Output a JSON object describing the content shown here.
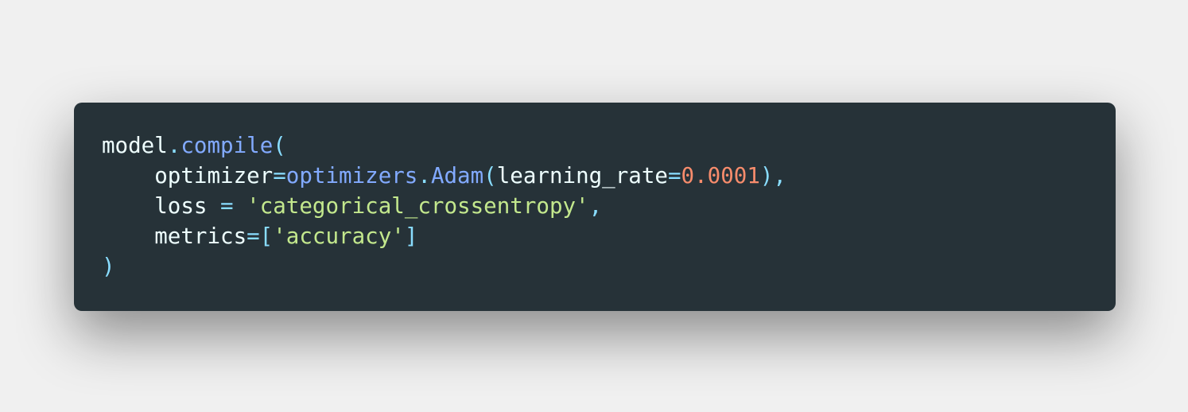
{
  "code_block": {
    "language": "python",
    "lines": [
      {
        "tokens": [
          {
            "text": "model",
            "type": "plain"
          },
          {
            "text": ".",
            "type": "punct"
          },
          {
            "text": "compile",
            "type": "func"
          },
          {
            "text": "(",
            "type": "punct"
          }
        ]
      },
      {
        "tokens": [
          {
            "text": "    optimizer",
            "type": "plain"
          },
          {
            "text": "=",
            "type": "punct"
          },
          {
            "text": "optimizers",
            "type": "func"
          },
          {
            "text": ".",
            "type": "punct"
          },
          {
            "text": "Adam",
            "type": "func"
          },
          {
            "text": "(",
            "type": "punct"
          },
          {
            "text": "learning_rate",
            "type": "plain"
          },
          {
            "text": "=",
            "type": "punct"
          },
          {
            "text": "0.0001",
            "type": "num"
          },
          {
            "text": "),",
            "type": "punct"
          }
        ]
      },
      {
        "tokens": [
          {
            "text": "    loss ",
            "type": "plain"
          },
          {
            "text": "=",
            "type": "punct"
          },
          {
            "text": " ",
            "type": "plain"
          },
          {
            "text": "'categorical_crossentropy'",
            "type": "str"
          },
          {
            "text": ",",
            "type": "punct"
          }
        ]
      },
      {
        "tokens": [
          {
            "text": "    metrics",
            "type": "plain"
          },
          {
            "text": "=[",
            "type": "punct"
          },
          {
            "text": "'accuracy'",
            "type": "str"
          },
          {
            "text": "]",
            "type": "punct"
          }
        ]
      },
      {
        "tokens": [
          {
            "text": ")",
            "type": "punct"
          }
        ]
      }
    ]
  },
  "colors": {
    "page_background": "#f0f0f0",
    "card_background": "#263238",
    "plain": "#eeffff",
    "punctuation": "#89ddff",
    "function": "#82aaff",
    "number": "#f78c6c",
    "string": "#c3e88d"
  }
}
